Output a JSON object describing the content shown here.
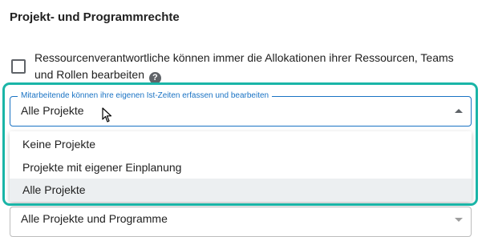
{
  "section": {
    "title": "Projekt- und Programmrechte"
  },
  "checkbox": {
    "checked": false,
    "label": "Ressourcenverantwortliche können immer die Allokationen ihrer Ressourcen, Teams und Rollen bearbeiten",
    "help_icon": "question-circle-icon"
  },
  "select": {
    "legend": "Mitarbeitende können ihre eigenen Ist-Zeiten erfassen und bearbeiten",
    "value": "Alle Projekte",
    "arrow_icon": "arrow-up-icon",
    "accent_color": "#1a73c4"
  },
  "dropdown": {
    "options": [
      {
        "label": "Keine Projekte",
        "selected": false
      },
      {
        "label": "Projekte mit eigener Einplanung",
        "selected": false
      },
      {
        "label": "Alle Projekte",
        "selected": true
      }
    ]
  },
  "next_field": {
    "value": "Alle Projekte und Programme",
    "arrow_icon": "arrow-down-icon"
  },
  "highlight": {
    "color": "#1ab5a7"
  }
}
